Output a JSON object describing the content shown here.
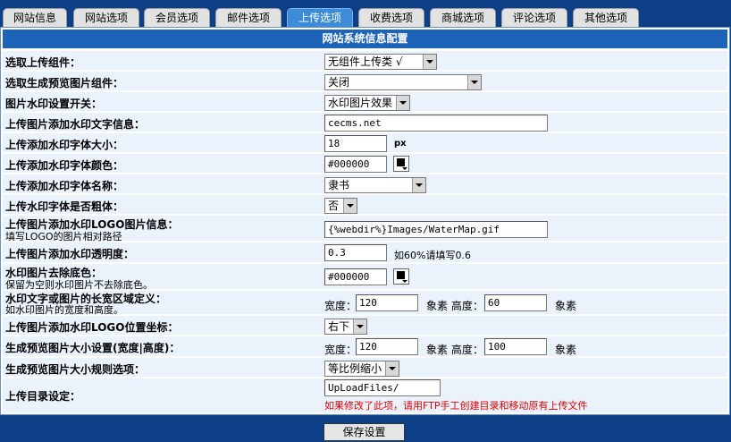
{
  "tabs": [
    "网站信息",
    "网站选项",
    "会员选项",
    "邮件选项",
    "上传选项",
    "收费选项",
    "商城选项",
    "评论选项",
    "其他选项"
  ],
  "active_tab": "上传选项",
  "section_title": "网站系统信息配置",
  "rows": {
    "upload_component": {
      "label": "选取上传组件：",
      "value": "无组件上传类 √"
    },
    "preview_component": {
      "label": "选取生成预览图片组件：",
      "value": "关闭"
    },
    "watermark_switch": {
      "label": "图片水印设置开关：",
      "value": "水印图片效果"
    },
    "watermark_text": {
      "label": "上传图片添加水印文字信息：",
      "value": "cecms.net"
    },
    "font_size": {
      "label": "上传添加水印字体大小：",
      "value": "18",
      "unit": "px"
    },
    "font_color": {
      "label": "上传添加水印字体颜色：",
      "value": "#000000"
    },
    "font_name": {
      "label": "上传添加水印字体名称：",
      "value": "隶书"
    },
    "font_bold": {
      "label": "上传水印字体是否粗体：",
      "value": "否"
    },
    "logo_info": {
      "label": "上传图片添加水印LOGO图片信息：",
      "sub": "填写LOGO的图片相对路径",
      "value": "{%webdir%}Images/WaterMap.gif"
    },
    "opacity": {
      "label": "上传图片添加水印透明度：",
      "value": "0.3",
      "hint": "如60%请填写0.6"
    },
    "remove_bg": {
      "label": "水印图片去除底色：",
      "sub": "保留为空则水印图片不去除底色。",
      "value": "#000000"
    },
    "wm_area": {
      "label": "水印文字或图片的长宽区域定义：",
      "sub": "如水印图片的宽度和高度。",
      "width_label": "宽度：",
      "width": "120",
      "height_label": "象素 高度：",
      "height": "60",
      "unit": "象素"
    },
    "logo_pos": {
      "label": "上传图片添加水印LOGO位置坐标：",
      "value": "右下"
    },
    "preview_size": {
      "label": "生成预览图片大小设置(宽度|高度)：",
      "width_label": "宽度：",
      "width": "120",
      "height_label": "象素 高度：",
      "height": "100",
      "unit": "象素"
    },
    "preview_rule": {
      "label": "生成预览图片大小规则选项：",
      "value": "等比例缩小"
    },
    "upload_dir": {
      "label": "上传目录设定：",
      "value": "UpLoadFiles/",
      "warning": "如果修改了此项，请用FTP手工创建目录和移动原有上传文件"
    }
  },
  "save_label": "保存设置",
  "colors": {
    "background": "#0d3f86",
    "title_bar": "#1d63b7",
    "row_bg": "#eaf2fc",
    "active_tab": "#3d8cd8",
    "warning": "#e00000"
  }
}
